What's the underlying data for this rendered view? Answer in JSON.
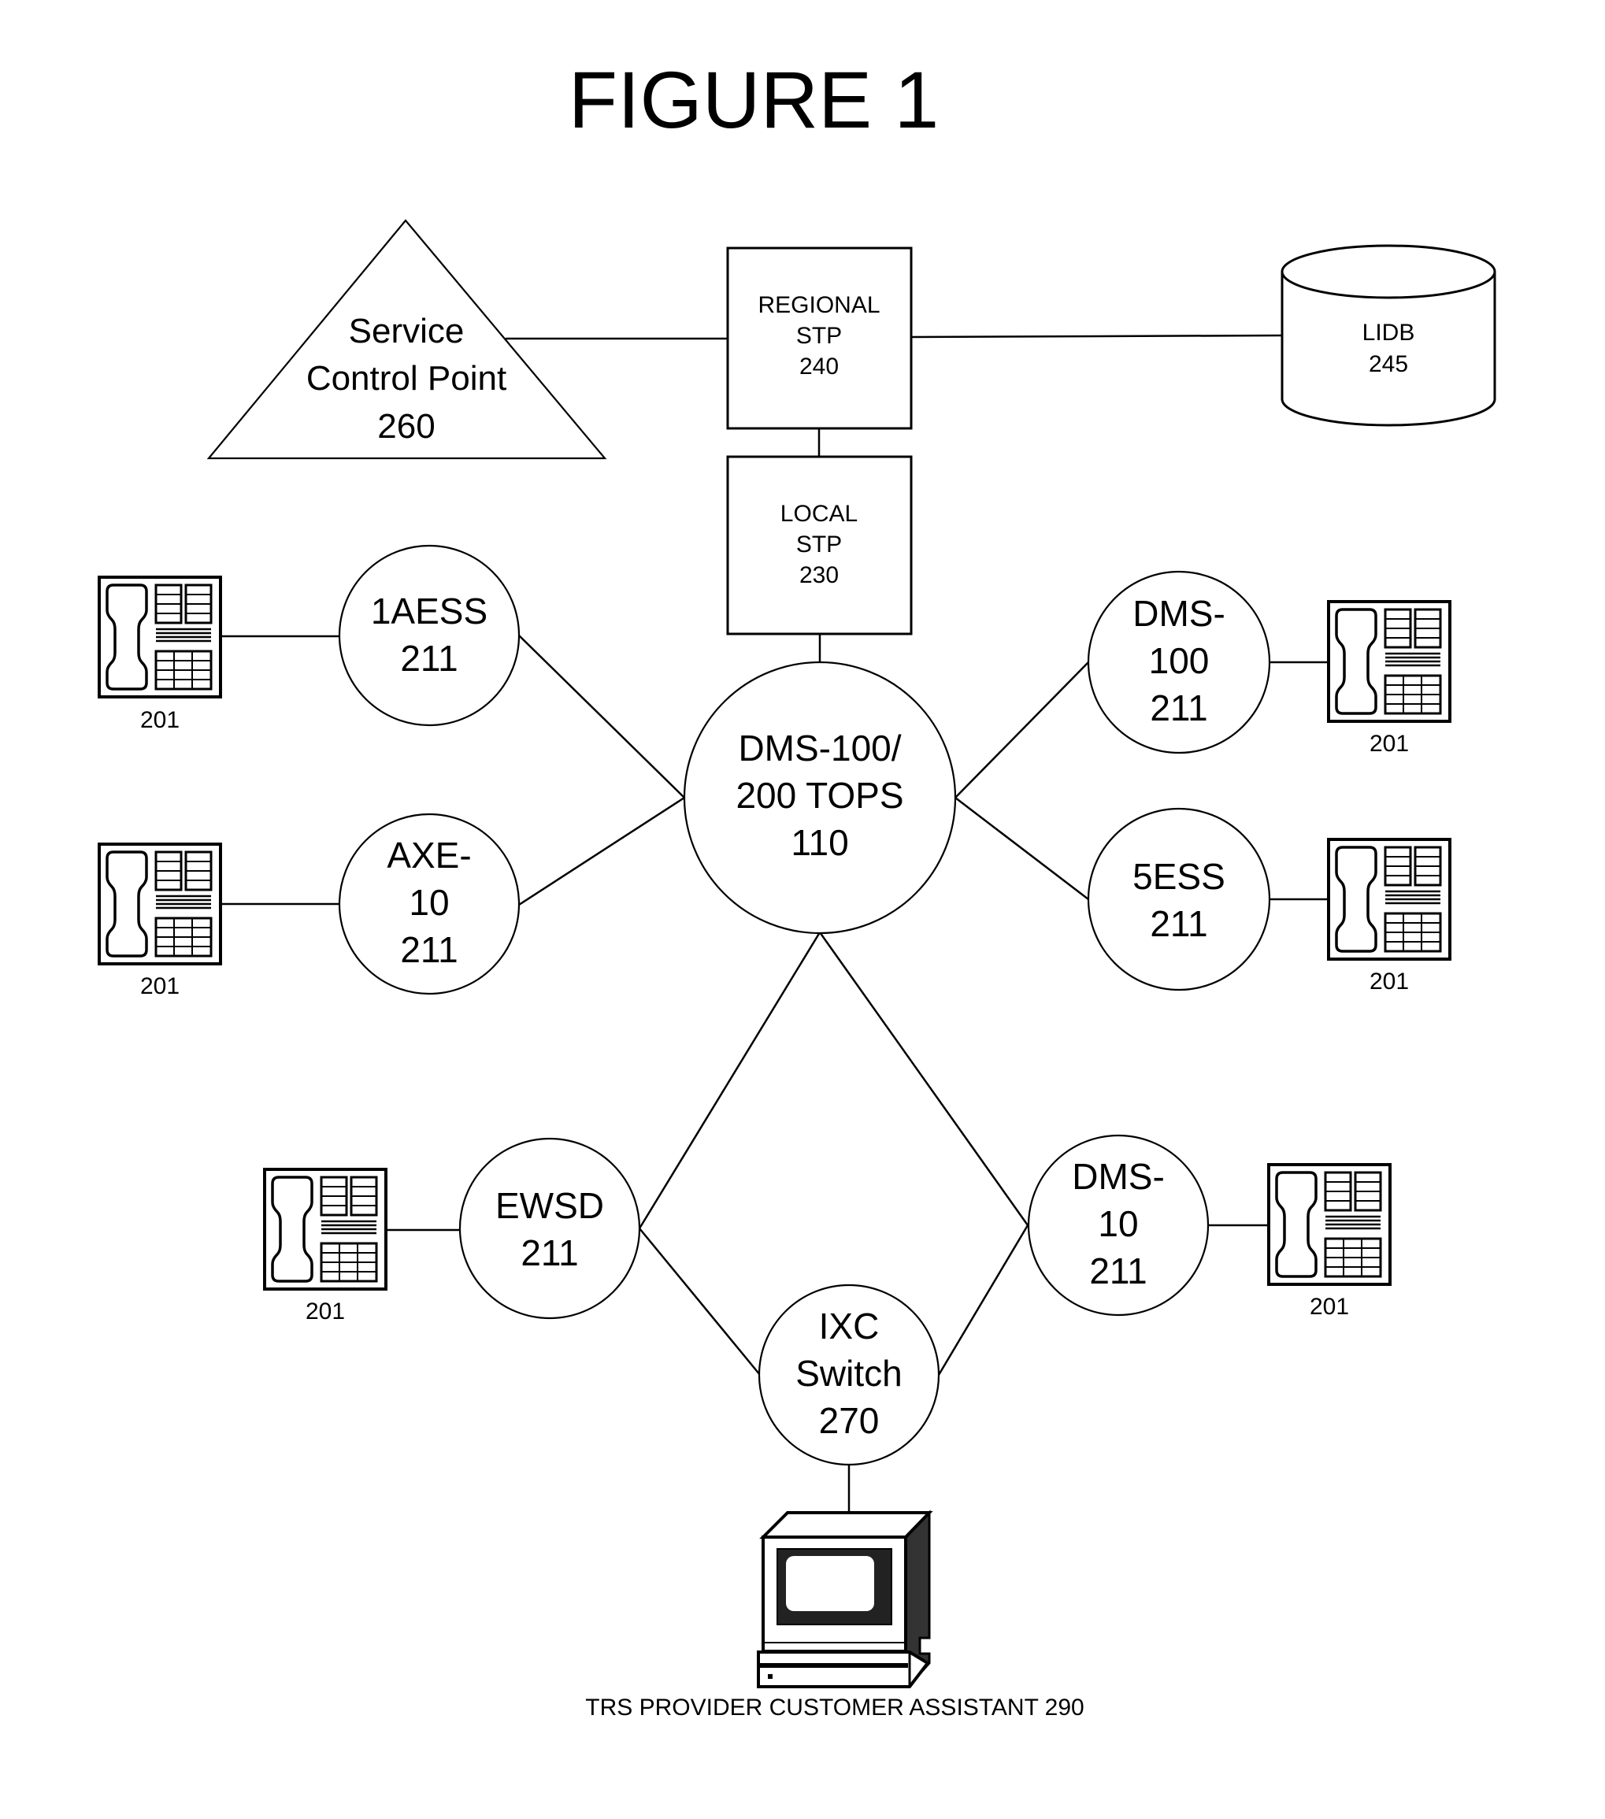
{
  "title": "FIGURE 1",
  "nodes": {
    "scp": {
      "lines": [
        "Service",
        "Control Point",
        "260"
      ]
    },
    "regional_stp": {
      "lines": [
        "REGIONAL",
        "STP",
        "240"
      ]
    },
    "local_stp": {
      "lines": [
        "LOCAL",
        "STP",
        "230"
      ]
    },
    "lidb": {
      "lines": [
        "LIDB",
        "245"
      ]
    },
    "tops": {
      "lines": [
        "DMS-100/",
        "200 TOPS",
        "110"
      ]
    },
    "aess": {
      "lines": [
        "1AESS",
        "211"
      ]
    },
    "axe": {
      "lines": [
        "AXE-",
        "10",
        "211"
      ]
    },
    "dms100": {
      "lines": [
        "DMS-",
        "100",
        "211"
      ]
    },
    "ess5": {
      "lines": [
        "5ESS",
        "211"
      ]
    },
    "ewsd": {
      "lines": [
        "EWSD",
        "211"
      ]
    },
    "dms10": {
      "lines": [
        "DMS-",
        "10",
        "211"
      ]
    },
    "ixc": {
      "lines": [
        "IXC",
        "Switch",
        "270"
      ]
    }
  },
  "phones": [
    {
      "label": "201",
      "attached_to": "1AESS 211"
    },
    {
      "label": "201",
      "attached_to": "AXE-10 211"
    },
    {
      "label": "201",
      "attached_to": "DMS-100 211"
    },
    {
      "label": "201",
      "attached_to": "5ESS 211"
    },
    {
      "label": "201",
      "attached_to": "EWSD 211"
    },
    {
      "label": "201",
      "attached_to": "DMS-10 211"
    }
  ],
  "terminal": {
    "caption": "TRS PROVIDER CUSTOMER ASSISTANT 290",
    "icon": "computer-terminal-icon"
  },
  "phone_icon": "telephone-icon",
  "colors": {
    "ink": "#000000",
    "background": "#ffffff"
  }
}
